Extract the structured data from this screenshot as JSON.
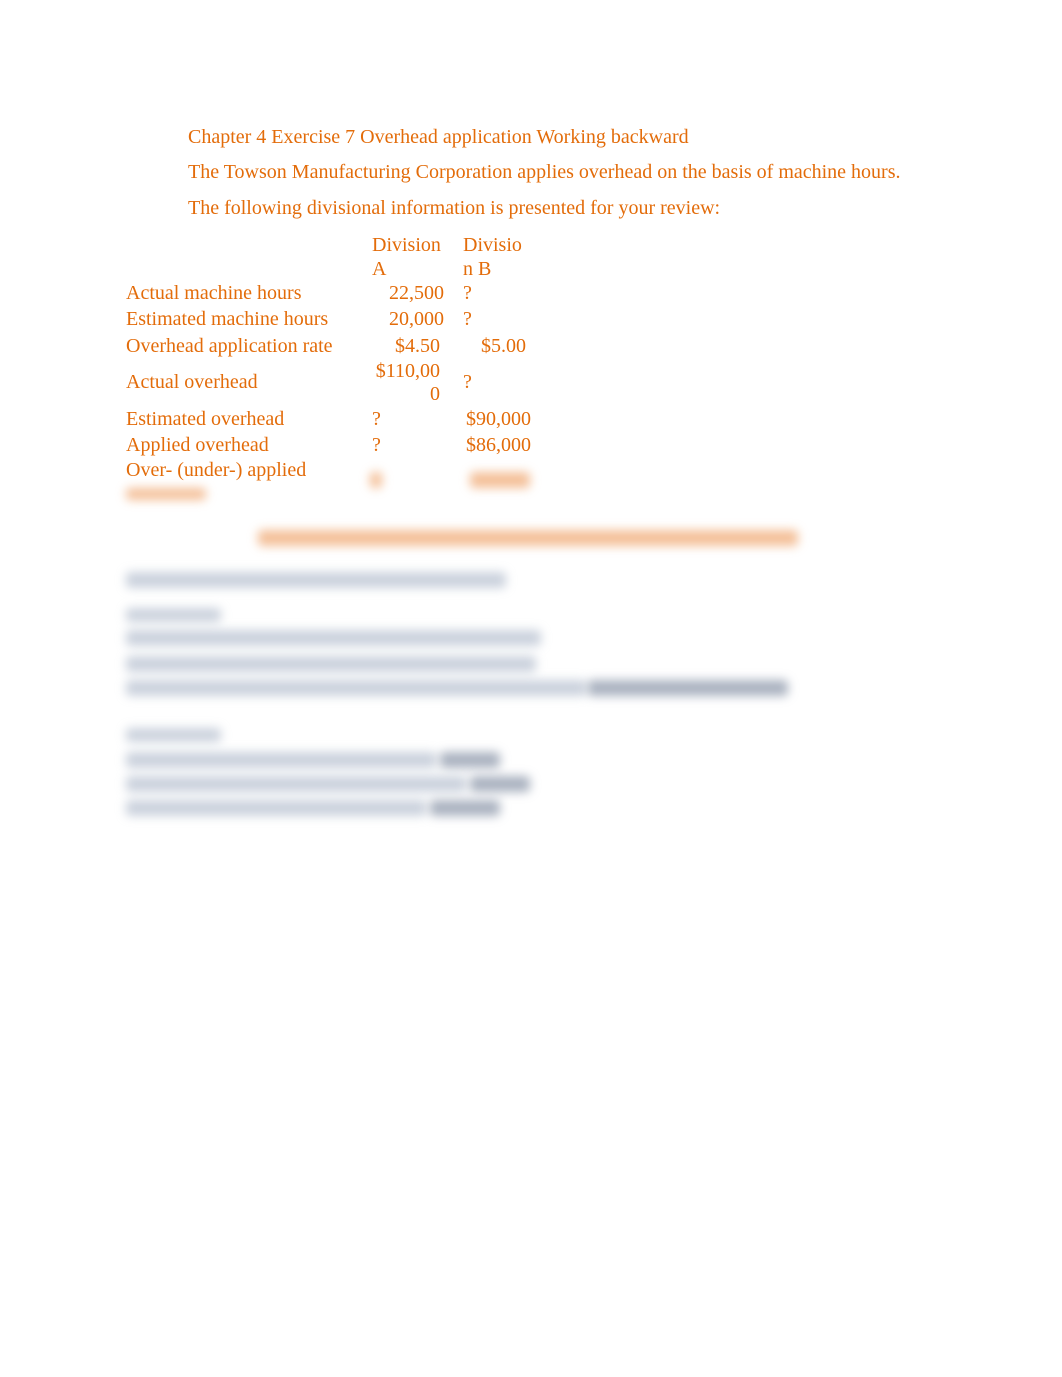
{
  "document": {
    "title": "Chapter 4 Exercise 7 Overhead application Working backward",
    "intro_1": "The Towson Manufacturing Corporation applies overhead on the basis of machine hours.",
    "intro_2": "The following divisional information is presented for your review:",
    "accent_color": "#E36C0A"
  },
  "table": {
    "headers": {
      "division_a_line1": "Division",
      "division_a_line2": "A",
      "division_b_line1": "Divisio",
      "division_b_line2": "n B"
    },
    "rows": [
      {
        "label": "Actual machine hours",
        "division_a": "22,500",
        "division_b": "?"
      },
      {
        "label": "Estimated machine hours",
        "division_a": "20,000",
        "division_b": "?"
      },
      {
        "label": "Overhead application rate",
        "division_a": "$4.50",
        "division_b": "$5.00"
      },
      {
        "label": "Actual overhead",
        "division_a_line1": "$110,00",
        "division_a_line2": "0",
        "division_b": "?"
      },
      {
        "label": "Estimated overhead",
        "division_a": "?",
        "division_b": "$90,000"
      },
      {
        "label": "Applied overhead",
        "division_a": "?",
        "division_b": "$86,000"
      },
      {
        "label": "Over- (under-) applied",
        "division_a": "",
        "division_b": ""
      }
    ]
  },
  "obscured": {
    "note": "Remaining content (solution section) is blurred"
  }
}
